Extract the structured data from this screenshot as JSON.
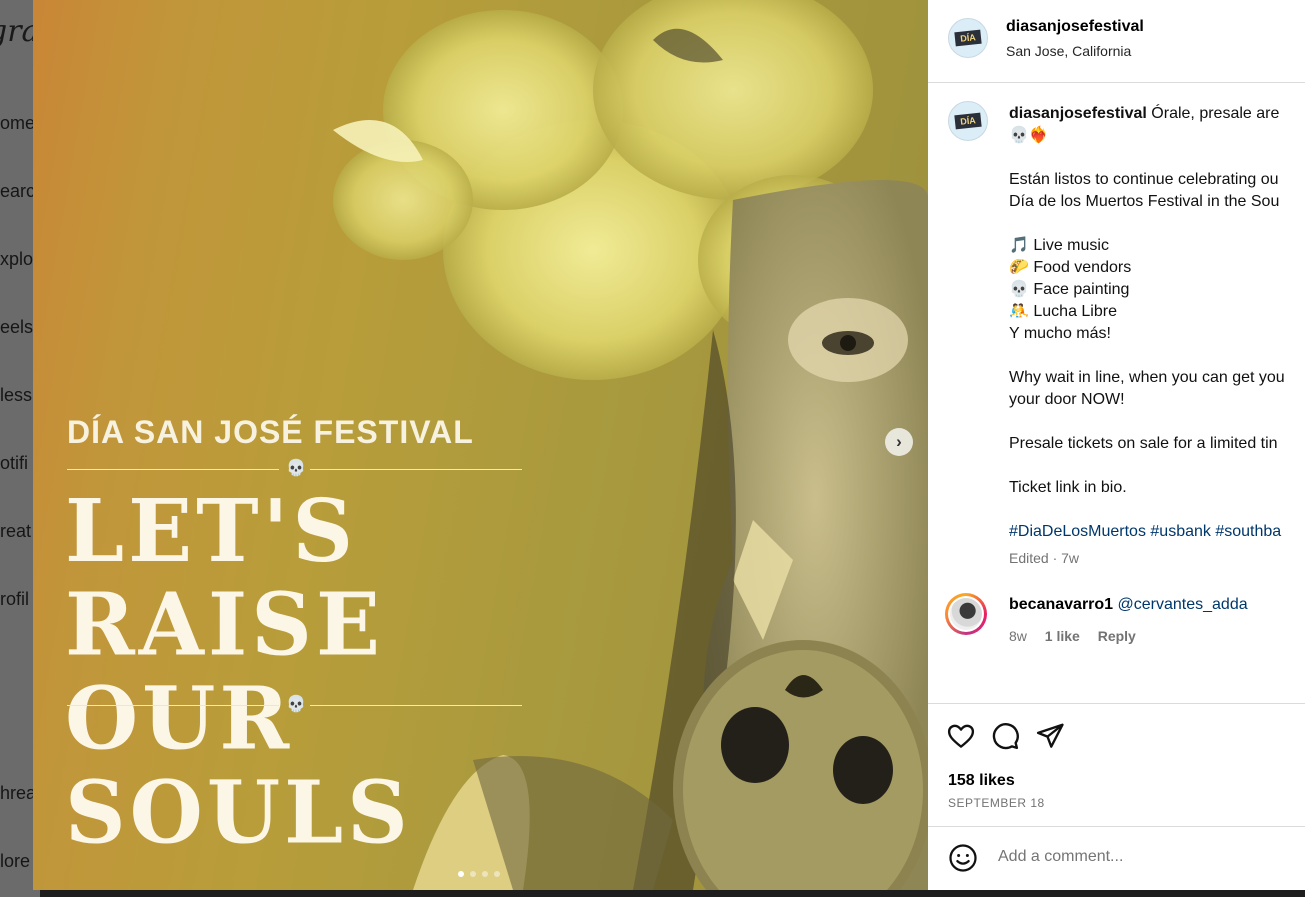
{
  "background": {
    "logo_fragment": "gra",
    "nav_fragments": [
      "ome",
      "earc",
      "xplo",
      "eels",
      "less",
      "otifi",
      "reat",
      "rofil",
      "hrea",
      "lore"
    ]
  },
  "post": {
    "tagline": "DÍA SAN JOSÉ FESTIVAL",
    "headline_line1": "LET'S RAISE",
    "headline_line2": "OUR SOULS",
    "carousel": {
      "total": 4,
      "active_index": 0
    },
    "next_icon": "chevron-right-icon"
  },
  "panel": {
    "header": {
      "username": "diasanjosefestival",
      "location": "San Jose, California",
      "avatar_text": "DÍA"
    },
    "caption": {
      "username": "diasanjosefestival",
      "first_line": "Órale, presale are",
      "emojis_line": "💀❤️‍🔥",
      "lines_a": [
        "Están listos to continue celebrating ou",
        "Día de los Muertos Festival in the Sou"
      ],
      "lines_b": [
        "🎵 Live music",
        "🌮 Food vendors",
        "💀 Face painting",
        "🤼 Lucha Libre",
        "Y mucho más!"
      ],
      "lines_c": [
        "Why wait in line, when you can get you",
        "your door NOW!"
      ],
      "line_d": "Presale tickets on sale for a limited tin",
      "line_e": "Ticket link in bio.",
      "hashtags": "#DiaDeLosMuertos #usbank #southba",
      "edited": "Edited · 7w"
    },
    "comment": {
      "username": "becanavarro1",
      "mention": "@cervantes_adda",
      "time": "8w",
      "likes": "1 like",
      "reply": "Reply"
    },
    "actions": {
      "icons": [
        "heart-icon",
        "comment-icon",
        "share-icon"
      ]
    },
    "likes": "158 likes",
    "date": "SEPTEMBER 18",
    "add_comment": {
      "placeholder": "Add a comment...",
      "emoji_icon": "emoji-icon"
    }
  }
}
